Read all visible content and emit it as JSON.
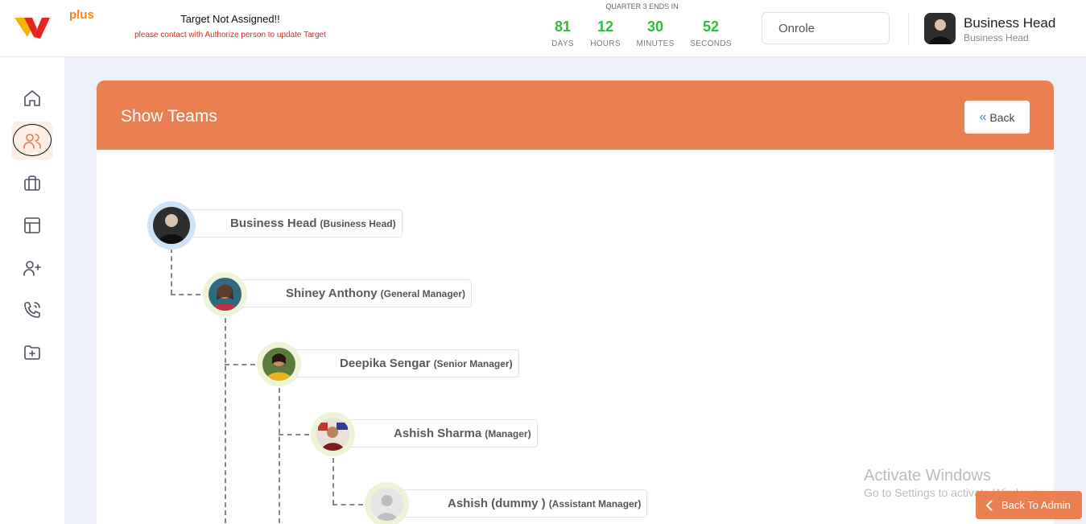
{
  "brand": {
    "plus_label": "plus"
  },
  "target": {
    "title": "Target Not Assigned!!",
    "subtitle": "please contact with Authorize person to update Target"
  },
  "countdown": {
    "label": "QUARTER 3 ENDS IN",
    "days": {
      "value": "81",
      "label": "DAYS"
    },
    "hours": {
      "value": "12",
      "label": "HOURS"
    },
    "minutes": {
      "value": "30",
      "label": "MINUTES"
    },
    "seconds": {
      "value": "52",
      "label": "SECONDS"
    }
  },
  "role_select": {
    "value": "Onrole"
  },
  "user": {
    "name": "Business Head",
    "role": "Business Head"
  },
  "sidebar": {
    "items": [
      {
        "name": "home",
        "icon": "home-icon"
      },
      {
        "name": "teams",
        "icon": "users-icon",
        "active": true
      },
      {
        "name": "briefcase",
        "icon": "briefcase-icon"
      },
      {
        "name": "layout",
        "icon": "layout-icon"
      },
      {
        "name": "add-user",
        "icon": "user-plus-icon"
      },
      {
        "name": "calls",
        "icon": "phone-icon"
      },
      {
        "name": "folder",
        "icon": "folder-plus-icon"
      }
    ]
  },
  "page": {
    "title": "Show Teams",
    "back_label": "Back"
  },
  "tree": [
    {
      "name": "Business Head",
      "role": "(Business Head)"
    },
    {
      "name": "Shiney Anthony",
      "role": "(General Manager)"
    },
    {
      "name": "Deepika Sengar",
      "role": "(Senior Manager)"
    },
    {
      "name": "Ashish Sharma",
      "role": "(Manager)"
    },
    {
      "name": "Ashish (dummy )",
      "role": "(Assistant Manager)"
    }
  ],
  "watermark": {
    "line1": "Activate Windows",
    "line2": "Go to Settings to activate Windows."
  },
  "admin_button": {
    "label": "Back To Admin"
  },
  "colors": {
    "accent": "#ea7f51",
    "countdown": "#2fbe3a",
    "alert": "#e0261c"
  }
}
